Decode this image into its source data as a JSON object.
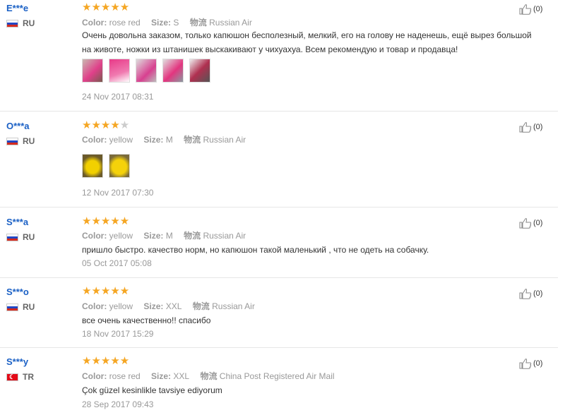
{
  "labels": {
    "color": "Color:",
    "size": "Size:",
    "shipping": "物流"
  },
  "colors": {
    "star": "#f5a623",
    "username": "#1a60c5"
  },
  "reviews": [
    {
      "user": "E***e",
      "country": "RU",
      "flag": "ru",
      "rating": 5,
      "color": "rose red",
      "size": "S",
      "shipping": "Russian Air",
      "text": "Очень довольна заказом, только капюшон бесполезный, мелкий, его на голову не наденешь, ещё вырез большой на животе, ножки из штанишек выскакивают у чихуахуа. Всем рекомендую и товар и продавца!",
      "photos": 5,
      "date": "24 Nov 2017 08:31",
      "likes": "(0)"
    },
    {
      "user": "O***a",
      "country": "RU",
      "flag": "ru",
      "rating": 4,
      "color": "yellow",
      "size": "M",
      "shipping": "Russian Air",
      "text": "",
      "photos": 2,
      "date": "12 Nov 2017 07:30",
      "likes": "(0)"
    },
    {
      "user": "S***a",
      "country": "RU",
      "flag": "ru",
      "rating": 5,
      "color": "yellow",
      "size": "M",
      "shipping": "Russian Air",
      "text": "пришло быстро. качество норм, но капюшон такой маленький , что не одеть на собачку.",
      "photos": 0,
      "date": "05 Oct 2017 05:08",
      "likes": "(0)"
    },
    {
      "user": "S***o",
      "country": "RU",
      "flag": "ru",
      "rating": 5,
      "color": "yellow",
      "size": "XXL",
      "shipping": "Russian Air",
      "text": "все очень качественно!! спасибо",
      "photos": 0,
      "date": "18 Nov 2017 15:29",
      "likes": "(0)"
    },
    {
      "user": "S***y",
      "country": "TR",
      "flag": "tr",
      "rating": 5,
      "color": "rose red",
      "size": "XXL",
      "shipping": "China Post Registered Air Mail",
      "text": "Çok güzel kesinlikle tavsiye ediyorum",
      "photos": 0,
      "date": "28 Sep 2017 09:43",
      "likes": "(0)"
    }
  ]
}
